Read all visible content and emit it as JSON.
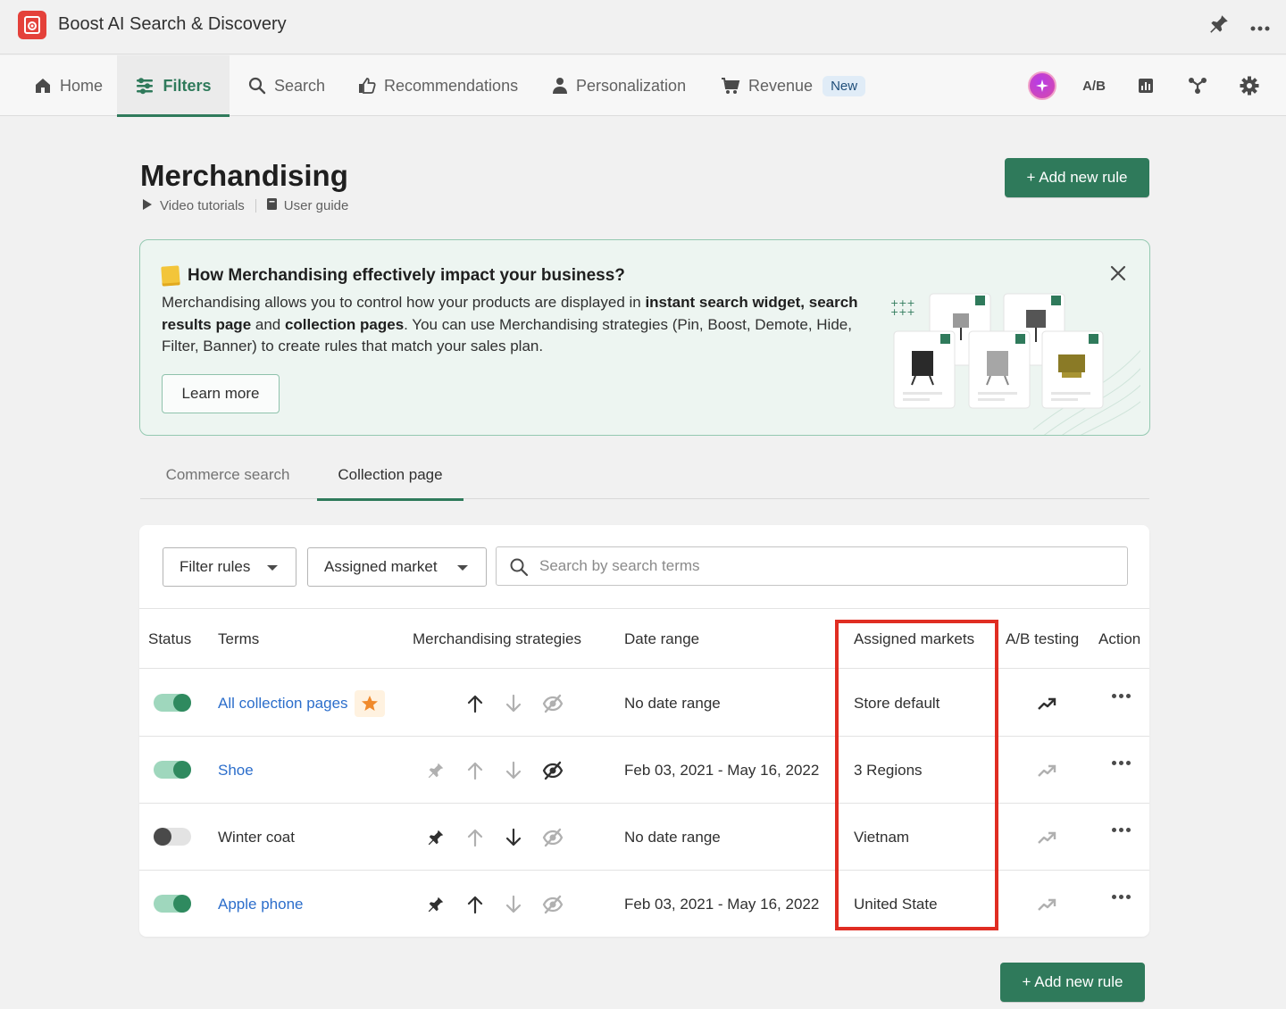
{
  "app": {
    "title": "Boost AI Search & Discovery",
    "logo_icon": "search-target-logo"
  },
  "nav": {
    "items": [
      {
        "label": "Home",
        "icon": "home-icon"
      },
      {
        "label": "Filters",
        "icon": "filters-icon",
        "active": true
      },
      {
        "label": "Search",
        "icon": "search-icon"
      },
      {
        "label": "Recommendations",
        "icon": "thumbs-up-icon"
      },
      {
        "label": "Personalization",
        "icon": "user-icon"
      },
      {
        "label": "Revenue",
        "icon": "cart-icon",
        "badge": "New"
      }
    ],
    "right": {
      "ab_label": "A/B"
    }
  },
  "header": {
    "title": "Merchandising",
    "video_link": "Video tutorials",
    "guide_link": "User guide",
    "add_button": "+ Add new rule"
  },
  "banner": {
    "title": "How Merchandising effectively impact your business?",
    "text_1": "Merchandising allows you to control how your products are displayed in ",
    "bold_1": "instant search widget,",
    "bold_2": "search results page",
    "text_2": " and ",
    "bold_3": "collection pages",
    "text_3": ". You can use Merchandising strategies (Pin, Boost, Demote, Hide, Filter, Banner) to create rules that match your sales plan.",
    "learn_more": "Learn more"
  },
  "tabs": [
    {
      "label": "Commerce search"
    },
    {
      "label": "Collection page",
      "active": true
    }
  ],
  "filters": {
    "filter_rules": "Filter rules",
    "assigned_market": "Assigned market",
    "search_placeholder": "Search by search terms"
  },
  "table": {
    "columns": [
      "Status",
      "Terms",
      "Merchandising strategies",
      "Date range",
      "Assigned markets",
      "A/B testing",
      "Action"
    ],
    "rows": [
      {
        "status": "on",
        "term": "All collection pages",
        "is_link": true,
        "starred": true,
        "pin": null,
        "boost": "dark",
        "demote": "light",
        "hide": "light",
        "date_range": "No date range",
        "market": "Store default",
        "ab": "dark"
      },
      {
        "status": "on",
        "term": "Shoe",
        "is_link": true,
        "starred": false,
        "pin": "light",
        "boost": "light",
        "demote": "light",
        "hide": "dark",
        "date_range": "Feb 03, 2021 - May 16, 2022",
        "market": "3 Regions",
        "ab": "light"
      },
      {
        "status": "off",
        "term": "Winter coat",
        "is_link": false,
        "starred": false,
        "pin": "dark",
        "boost": "light",
        "demote": "dark",
        "hide": "light",
        "date_range": "No date range",
        "market": "Vietnam",
        "ab": "light"
      },
      {
        "status": "on",
        "term": "Apple phone",
        "is_link": true,
        "starred": false,
        "pin": "dark",
        "boost": "dark",
        "demote": "light",
        "hide": "light",
        "date_range": "Feb 03, 2021 - May 16, 2022",
        "market": "United State",
        "ab": "light"
      }
    ]
  },
  "footer": {
    "add_button": "+ Add new rule"
  },
  "colors": {
    "primary": "#2f7a5b",
    "link": "#2c6ecb",
    "highlight": "#e02d22",
    "toggle_on": "#2f8a5f",
    "star": "#f08a2c"
  }
}
